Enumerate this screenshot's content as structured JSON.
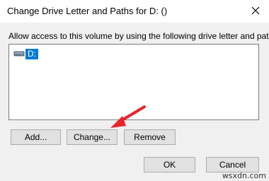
{
  "window": {
    "title": "Change Drive Letter and Paths for D: ()",
    "close_icon": "close-icon"
  },
  "instruction": "Allow access to this volume by using the following drive letter and paths:",
  "list": {
    "items": [
      {
        "label": "D:",
        "icon": "drive-icon",
        "selected": true
      }
    ]
  },
  "buttons": {
    "add": "Add...",
    "change": "Change...",
    "remove": "Remove",
    "ok": "OK",
    "cancel": "Cancel"
  },
  "annotation": {
    "icon": "red-arrow-icon",
    "color": "#e8242a"
  },
  "watermark": "wsxdn.com",
  "colors": {
    "selection": "#0078d7",
    "dialog_bg": "#f0f0f0",
    "button_bg": "#e1e1e1"
  }
}
